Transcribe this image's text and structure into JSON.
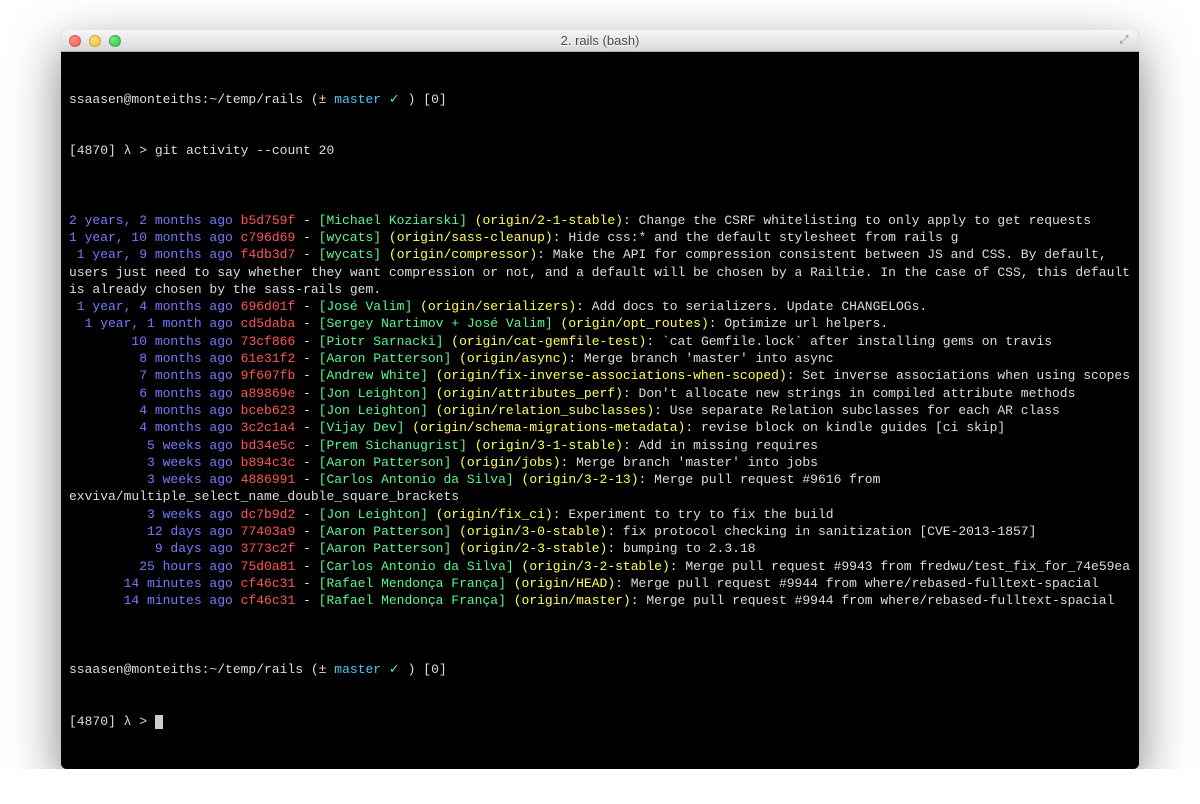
{
  "window": {
    "title": "2. rails (bash)"
  },
  "prompt1": {
    "host": "ssaasen@monteiths:~/temp/rails",
    "git_open": "(",
    "git_sym": "±",
    "branch": "master",
    "check": "✓",
    "git_close": ")",
    "status": "[0]",
    "prefix": "[4870] λ > ",
    "command": "git activity --count 20"
  },
  "entries": [
    {
      "age": "2 years, 2 months ago",
      "hash": "b5d759f",
      "author": "Michael Koziarski",
      "branch": "origin/2-1-stable",
      "msg": ": Change the CSRF whitelisting to only apply to get requests"
    },
    {
      "age": "1 year, 10 months ago",
      "hash": "c796d69",
      "author": "wycats",
      "branch": "origin/sass-cleanup",
      "msg": ": Hide css:* and the default stylesheet from rails g"
    },
    {
      "age": "1 year, 9 months ago",
      "hash": "f4db3d7",
      "author": "wycats",
      "branch": "origin/compressor",
      "msg": ": Make the API for compression consistent between JS and CSS. By default, users just need to say whether they want compression or not, and a default will be chosen by a Railtie. In the case of CSS, this default is already chosen by the sass-rails gem."
    },
    {
      "age": "1 year, 4 months ago",
      "hash": "696d01f",
      "author": "José Valim",
      "branch": "origin/serializers",
      "msg": ": Add docs to serializers. Update CHANGELOGs."
    },
    {
      "age": "1 year, 1 month ago",
      "hash": "cd5daba",
      "author": "Sergey Nartimov + José Valim",
      "branch": "origin/opt_routes",
      "msg": ": Optimize url helpers."
    },
    {
      "age": "10 months ago",
      "hash": "73cf866",
      "author": "Piotr Sarnacki",
      "branch": "origin/cat-gemfile-test",
      "msg": ": `cat Gemfile.lock` after installing gems on travis"
    },
    {
      "age": "8 months ago",
      "hash": "61e31f2",
      "author": "Aaron Patterson",
      "branch": "origin/async",
      "msg": ": Merge branch 'master' into async"
    },
    {
      "age": "7 months ago",
      "hash": "9f607fb",
      "author": "Andrew White",
      "branch": "origin/fix-inverse-associations-when-scoped",
      "msg": ": Set inverse associations when using scopes"
    },
    {
      "age": "6 months ago",
      "hash": "a89869e",
      "author": "Jon Leighton",
      "branch": "origin/attributes_perf",
      "msg": ": Don't allocate new strings in compiled attribute methods"
    },
    {
      "age": "4 months ago",
      "hash": "bceb623",
      "author": "Jon Leighton",
      "branch": "origin/relation_subclasses",
      "msg": ": Use separate Relation subclasses for each AR class"
    },
    {
      "age": "4 months ago",
      "hash": "3c2c1a4",
      "author": "Vijay Dev",
      "branch": "origin/schema-migrations-metadata",
      "msg": ": revise block on kindle guides [ci skip]"
    },
    {
      "age": "5 weeks ago",
      "hash": "bd34e5c",
      "author": "Prem Sichanugrist",
      "branch": "origin/3-1-stable",
      "msg": ": Add in missing requires"
    },
    {
      "age": "3 weeks ago",
      "hash": "b894c3c",
      "author": "Aaron Patterson",
      "branch": "origin/jobs",
      "msg": ": Merge branch 'master' into jobs"
    },
    {
      "age": "3 weeks ago",
      "hash": "4886991",
      "author": "Carlos Antonio da Silva",
      "branch": "origin/3-2-13",
      "msg": ": Merge pull request #9616 from exviva/multiple_select_name_double_square_brackets"
    },
    {
      "age": "3 weeks ago",
      "hash": "dc7b9d2",
      "author": "Jon Leighton",
      "branch": "origin/fix_ci",
      "msg": ": Experiment to try to fix the build"
    },
    {
      "age": "12 days ago",
      "hash": "77403a9",
      "author": "Aaron Patterson",
      "branch": "origin/3-0-stable",
      "msg": ": fix protocol checking in sanitization [CVE-2013-1857]"
    },
    {
      "age": "9 days ago",
      "hash": "3773c2f",
      "author": "Aaron Patterson",
      "branch": "origin/2-3-stable",
      "msg": ": bumping to 2.3.18"
    },
    {
      "age": "25 hours ago",
      "hash": "75d0a81",
      "author": "Carlos Antonio da Silva",
      "branch": "origin/3-2-stable",
      "msg": ": Merge pull request #9943 from fredwu/test_fix_for_74e59ea"
    },
    {
      "age": "14 minutes ago",
      "hash": "cf46c31",
      "author": "Rafael Mendonça França",
      "branch": "origin/HEAD",
      "msg": ": Merge pull request #9944 from where/rebased-fulltext-spacial"
    },
    {
      "age": "14 minutes ago",
      "hash": "cf46c31",
      "author": "Rafael Mendonça França",
      "branch": "origin/master",
      "msg": ": Merge pull request #9944 from where/rebased-fulltext-spacial"
    }
  ],
  "prompt2": {
    "host": "ssaasen@monteiths:~/temp/rails",
    "git_open": "(",
    "git_sym": "±",
    "branch": "master",
    "check": "✓",
    "git_close": ")",
    "status": "[0]",
    "prefix": "[4870] λ > "
  },
  "age_width": 21
}
